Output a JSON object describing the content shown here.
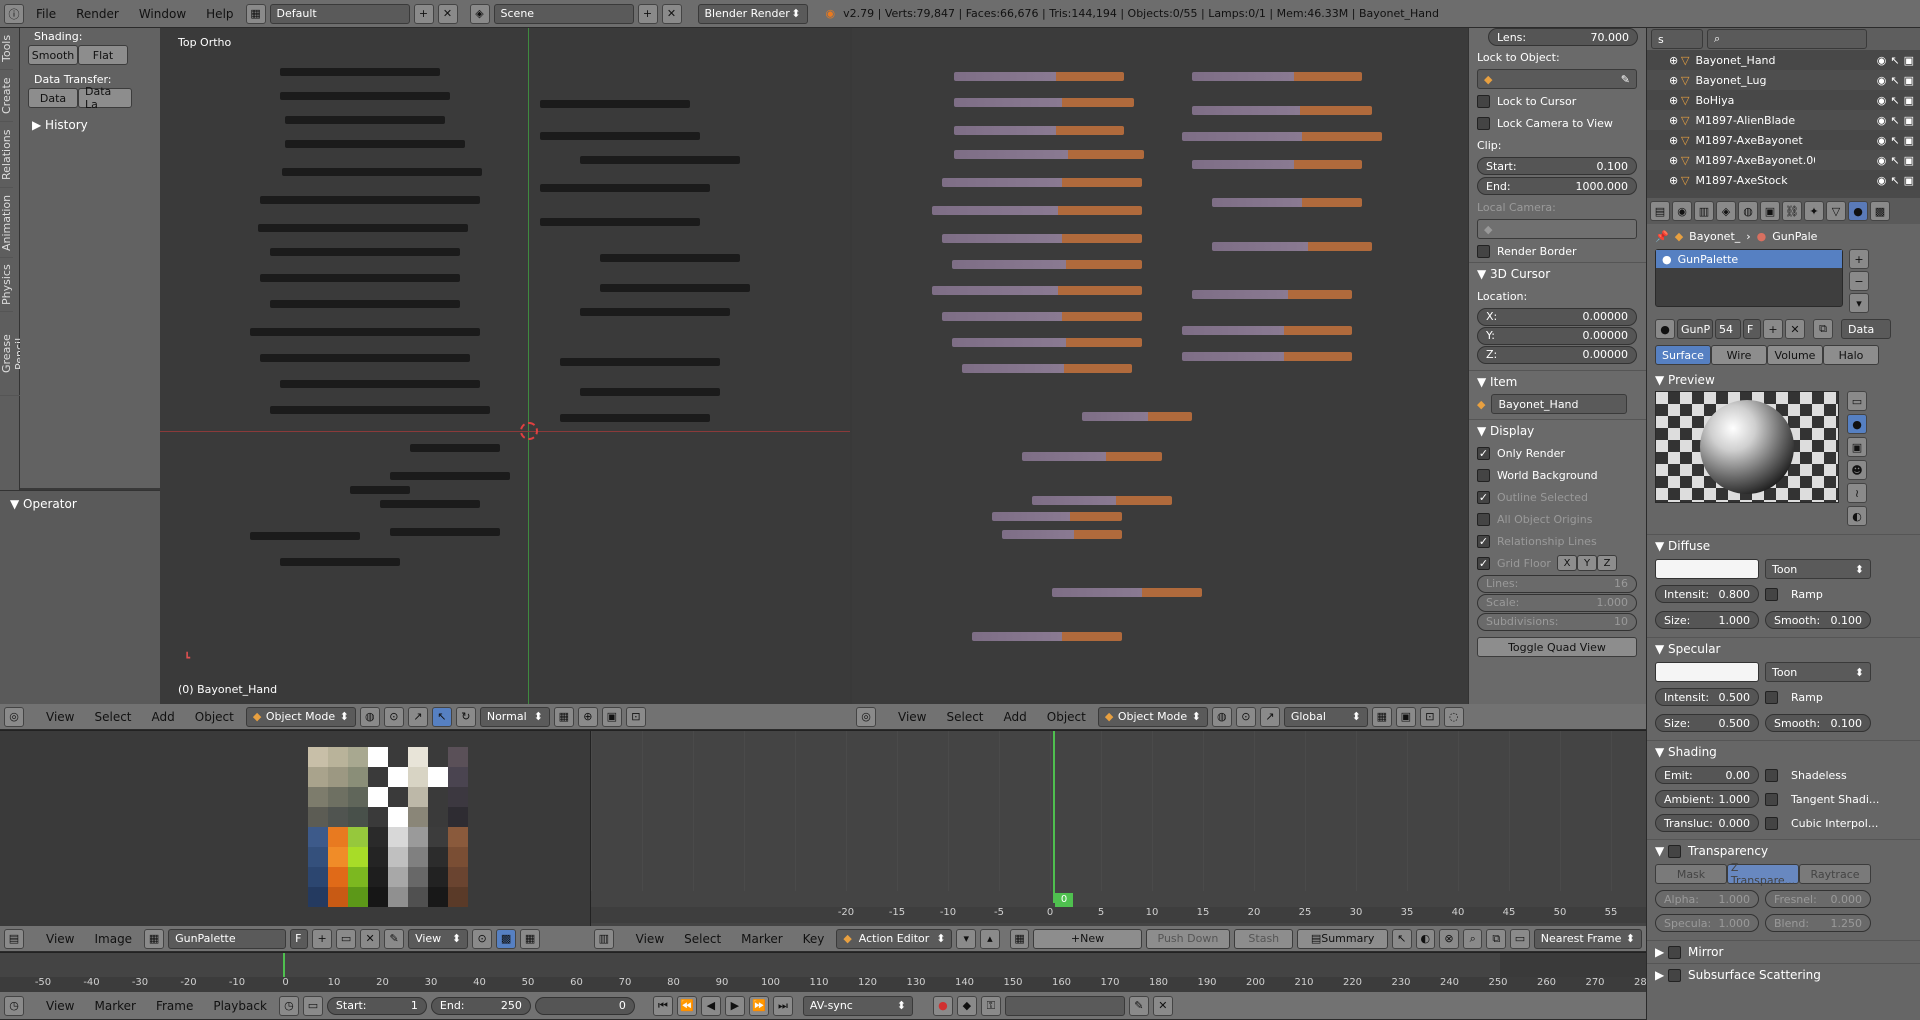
{
  "topbar": {
    "menus": [
      "File",
      "Render",
      "Window",
      "Help"
    ],
    "layout": "Default",
    "scene": "Scene",
    "engine": "Blender Render",
    "stats": "v2.79 | Verts:79,847 | Faces:66,676 | Tris:144,194 | Objects:0/55 | Lamps:0/1 | Mem:46.33M | Bayonet_Hand"
  },
  "toolshelf": {
    "tabs": [
      "Tools",
      "Create",
      "Relations",
      "Animation",
      "Physics",
      "Grease Pencil"
    ],
    "shading_label": "Shading:",
    "smooth": "Smooth",
    "flat": "Flat",
    "data_transfer_label": "Data Transfer:",
    "data": "Data",
    "data_la": "Data La",
    "history": "History",
    "operator": "Operator"
  },
  "viewport_left": {
    "title": "Top Ortho",
    "object_label": "(0) Bayonet_Hand",
    "menus": [
      "View",
      "Select",
      "Add",
      "Object"
    ],
    "mode": "Object Mode",
    "orientation": "Normal"
  },
  "viewport_right": {
    "menus": [
      "View",
      "Select",
      "Add",
      "Object"
    ],
    "mode": "Object Mode",
    "orientation": "Global"
  },
  "npanel": {
    "lens_label": "Lens:",
    "lens_value": "70.000",
    "lock_to_object": "Lock to Object:",
    "lock_object_value": "",
    "lock_to_cursor": "Lock to Cursor",
    "lock_camera": "Lock Camera to View",
    "clip": "Clip:",
    "start_label": "Start:",
    "start_value": "0.100",
    "end_label": "End:",
    "end_value": "1000.000",
    "local_camera": "Local Camera:",
    "render_border": "Render Border",
    "cursor_title": "3D Cursor",
    "location": "Location:",
    "x_label": "X:",
    "x_value": "0.00000",
    "y_label": "Y:",
    "y_value": "0.00000",
    "z_label": "Z:",
    "z_value": "0.00000",
    "item_title": "Item",
    "item_name": "Bayonet_Hand",
    "display_title": "Display",
    "only_render": "Only Render",
    "world_bg": "World Background",
    "outline_selected": "Outline Selected",
    "all_origins": "All Object Origins",
    "rel_lines": "Relationship Lines",
    "grid_floor": "Grid Floor",
    "gx": "X",
    "gy": "Y",
    "gz": "Z",
    "lines_label": "Lines:",
    "lines_value": "16",
    "scale_label": "Scale:",
    "scale_value": "1.000",
    "subdiv_label": "Subdivisions:",
    "subdiv_value": "10",
    "toggle_quad": "Toggle Quad View"
  },
  "outliner": {
    "tab": "s",
    "items": [
      "Bayonet_Hand",
      "Bayonet_Lug",
      "BoHiya",
      "M1897-AlienBlade",
      "M1897-AxeBayonet",
      "M1897-AxeBayonet.00",
      "M1897-AxeStock"
    ]
  },
  "properties": {
    "breadcrumb_object": "Bayonet_",
    "breadcrumb_material": "GunPale",
    "material_slot": "GunPalette",
    "mat_name": "GunP",
    "mat_users": "54",
    "mat_f": "F",
    "data_select": "Data",
    "tabs": [
      "Surface",
      "Wire",
      "Volume",
      "Halo"
    ],
    "preview_title": "Preview",
    "diffuse_title": "Diffuse",
    "diffuse_shader": "Toon",
    "diffuse_intensity_label": "Intensit:",
    "diffuse_intensity": "0.800",
    "ramp": "Ramp",
    "diffuse_size_label": "Size:",
    "diffuse_size": "1.000",
    "diffuse_smooth_label": "Smooth:",
    "diffuse_smooth": "0.100",
    "specular_title": "Specular",
    "specular_shader": "Toon",
    "spec_intensity_label": "Intensit:",
    "spec_intensity": "0.500",
    "spec_ramp": "Ramp",
    "spec_size_label": "Size:",
    "spec_size": "0.500",
    "spec_smooth_label": "Smooth:",
    "spec_smooth": "0.100",
    "shading_title": "Shading",
    "emit_label": "Emit:",
    "emit": "0.00",
    "shadeless": "Shadeless",
    "ambient_label": "Ambient:",
    "ambient": "1.000",
    "tangent": "Tangent Shadi...",
    "transluc_label": "Transluc:",
    "transluc": "0.000",
    "cubic": "Cubic Interpol...",
    "transparency_title": "Transparency",
    "trans_tabs": [
      "Mask",
      "Z Transpare...",
      "Raytrace"
    ],
    "alpha_label": "Alpha:",
    "alpha": "1.000",
    "fresnel_label": "Fresnel:",
    "fresnel": "0.000",
    "specula_label": "Specula:",
    "specula": "1.000",
    "blend_label": "Blend:",
    "blend": "1.250",
    "mirror_title": "Mirror",
    "sss_title": "Subsurface Scattering"
  },
  "image_editor": {
    "menus": [
      "View",
      "Image"
    ],
    "image_name": "GunPalette",
    "image_f": "F",
    "view": "View",
    "palette": [
      [
        "#c8bfa8",
        "#b9b39a",
        "#a8a890",
        "#ffffff",
        "#3a3a3a",
        "#e8e4d8",
        "#3a3a3a",
        "#5a5058"
      ],
      [
        "#a9a38c",
        "#9c9882",
        "#8a8e78",
        "#3a3a3a",
        "#ffffff",
        "#d8d4c4",
        "#ffffff",
        "#4a4450"
      ],
      [
        "#7d7c6c",
        "#6e7062",
        "#60665a",
        "#ffffff",
        "#3a3a3a",
        "#bdb8a8",
        "#3a3a3a",
        "#3c3840"
      ],
      [
        "#5c5c54",
        "#505450",
        "#48504a",
        "#3a3a3a",
        "#ffffff",
        "#8a8678",
        "#3a3a3a",
        "#2e2c32"
      ],
      [
        "#3d5a8a",
        "#e87a20",
        "#96c83c",
        "#2a2a2a",
        "#d8d8d8",
        "#9a9a9a",
        "#3c3c3c",
        "#8a5a3c"
      ],
      [
        "#34507c",
        "#f08c28",
        "#a8dc28",
        "#242424",
        "#c0c0c0",
        "#808080",
        "#2c2c2c",
        "#7a4e34"
      ],
      [
        "#2c4670",
        "#e06a18",
        "#7cb820",
        "#1e1e1e",
        "#a8a8a8",
        "#686868",
        "#222222",
        "#6a4430"
      ],
      [
        "#243a60",
        "#c85a14",
        "#5c9818",
        "#161616",
        "#909090",
        "#505050",
        "#181818",
        "#5a3a28"
      ]
    ]
  },
  "action_editor": {
    "menus": [
      "View",
      "Select",
      "Marker",
      "Key"
    ],
    "mode": "Action Editor",
    "new": "New",
    "push_down": "Push Down",
    "stash": "Stash",
    "summary": "Summary",
    "snap": "Nearest Frame",
    "current_frame_badge": "0",
    "ticks": [
      "-20",
      "-15",
      "-10",
      "-5",
      "0",
      "5",
      "10",
      "15",
      "20",
      "25",
      "30",
      "35",
      "40",
      "45",
      "50",
      "55"
    ]
  },
  "timeline": {
    "ticks": [
      "-50",
      "-40",
      "-30",
      "-20",
      "-10",
      "0",
      "10",
      "20",
      "30",
      "40",
      "50",
      "60",
      "70",
      "80",
      "90",
      "100",
      "110",
      "120",
      "130",
      "140",
      "150",
      "160",
      "170",
      "180",
      "190",
      "200",
      "210",
      "220",
      "230",
      "240",
      "250",
      "260",
      "270",
      "280"
    ],
    "menus": [
      "View",
      "Marker",
      "Frame",
      "Playback"
    ],
    "start_label": "Start:",
    "start": "1",
    "end_label": "End:",
    "end": "250",
    "current": "0",
    "sync": "AV-sync"
  }
}
